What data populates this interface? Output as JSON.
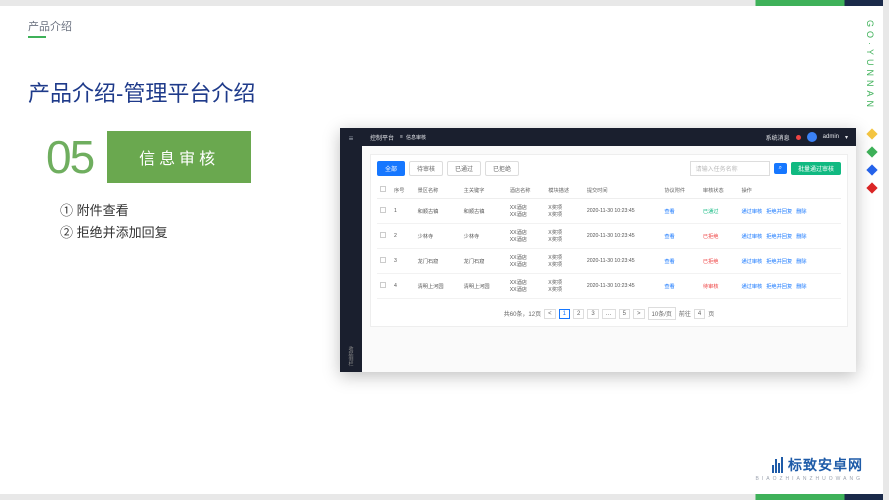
{
  "slide": {
    "tag": "产品介绍",
    "heading": "产品介绍-管理平台介绍",
    "number": "05",
    "badge": "信息审核",
    "bullet1": "① 附件查看",
    "bullet2": "② 拒绝并添加回复",
    "vertical_brand": "GO·YUNNAN"
  },
  "app": {
    "platform": "控制平台",
    "crumb_icon": "≡",
    "crumb": "信息审核",
    "msg": "系统消息",
    "user": "admin",
    "sidebar_bottom": "收起侧栏",
    "tabs": {
      "all": "全部",
      "pending": "待审核",
      "passed": "已通过",
      "rejected": "已拒绝"
    },
    "search_placeholder": "请输入任务名称",
    "search_icon": "⌕",
    "batch_btn": "批量通过审核",
    "columns": {
      "c0": "",
      "c1": "序号",
      "c2": "景区名称",
      "c3": "主关键字",
      "c4": "酒店名称",
      "c5": "模块描述",
      "c6": "提交时间",
      "c7": "协议附件",
      "c8": "审核状态",
      "c9": "操作"
    },
    "rows": [
      {
        "idx": "1",
        "scenic": "和顺古镇",
        "kw": "和顺古镇",
        "hotel1": "XX酒店",
        "hotel2": "XX酒店",
        "desc1": "X奖项",
        "desc2": "X奖项",
        "time": "2020-11-30 10:23:45",
        "att": "查看",
        "status": "已通过",
        "status_cls": "st-pass",
        "op1": "通过审核",
        "op2": "拒绝并回复",
        "op3": "删除"
      },
      {
        "idx": "2",
        "scenic": "少林寺",
        "kw": "少林寺",
        "hotel1": "XX酒店",
        "hotel2": "XX酒店",
        "desc1": "X奖项",
        "desc2": "X奖项",
        "time": "2020-11-30 10:23:45",
        "att": "查看",
        "status": "已拒绝",
        "status_cls": "st-reject",
        "op1": "通过审核",
        "op2": "拒绝并回复",
        "op3": "删除"
      },
      {
        "idx": "3",
        "scenic": "龙门石窟",
        "kw": "龙门石窟",
        "hotel1": "XX酒店",
        "hotel2": "XX酒店",
        "desc1": "X奖项",
        "desc2": "X奖项",
        "time": "2020-11-30 10:23:45",
        "att": "查看",
        "status": "已拒绝",
        "status_cls": "st-reject",
        "op1": "通过审核",
        "op2": "拒绝并回复",
        "op3": "删除"
      },
      {
        "idx": "4",
        "scenic": "清明上河园",
        "kw": "清明上河园",
        "hotel1": "XX酒店",
        "hotel2": "XX酒店",
        "desc1": "X奖项",
        "desc2": "X奖项",
        "time": "2020-11-30 10:23:45",
        "att": "查看",
        "status": "待审核",
        "status_cls": "st-pending",
        "op1": "通过审核",
        "op2": "拒绝并回复",
        "op3": "删除"
      }
    ],
    "pager": {
      "total": "共60条，12页",
      "p1": "1",
      "p2": "2",
      "p3": "3",
      "ell": "…",
      "p5": "5",
      "size": "10条/页",
      "goto": "前往",
      "goto_val": "4",
      "unit": "页"
    }
  },
  "logo": {
    "text": "标致安卓网",
    "sub": "BIAOZHIANZHUOWANG"
  }
}
